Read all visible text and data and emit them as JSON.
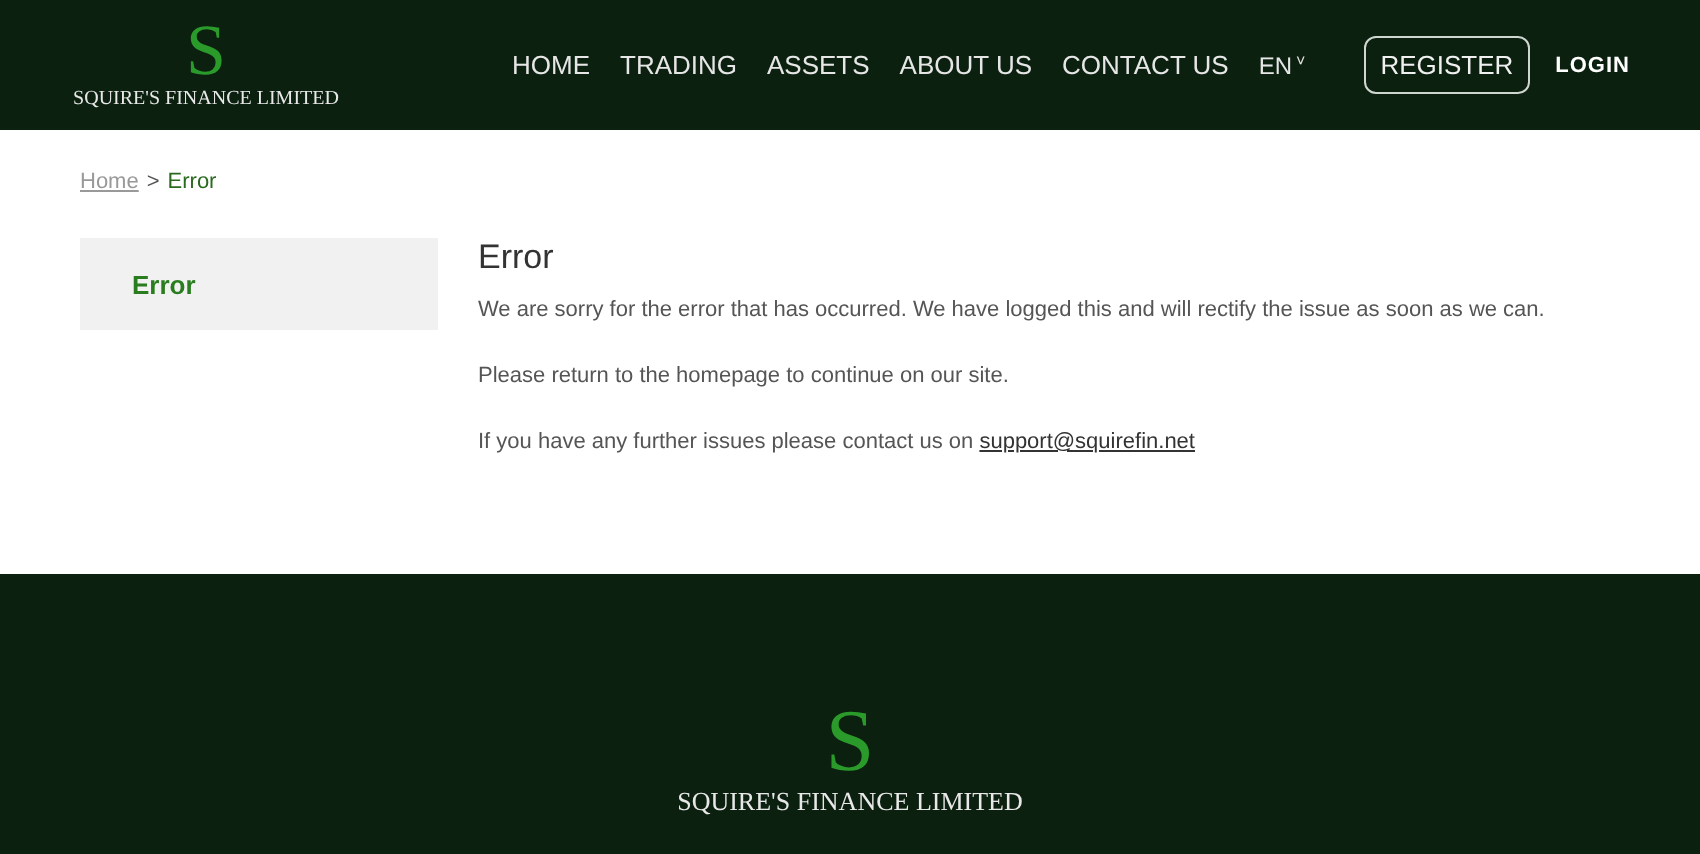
{
  "header": {
    "logo_letter": "S",
    "logo_name": "SQUIRE'S FINANCE LIMITED",
    "nav": [
      "HOME",
      "TRADING",
      "ASSETS",
      "ABOUT US",
      "CONTACT US"
    ],
    "language": "EN",
    "language_caret": "˅",
    "register": "REGISTER",
    "login": "LOGIN"
  },
  "breadcrumb": {
    "home": "Home",
    "separator": ">",
    "current": "Error"
  },
  "sidebar": {
    "items": [
      {
        "label": "Error",
        "selected": true
      }
    ]
  },
  "content": {
    "title": "Error",
    "paragraphs": [
      {
        "text": "We are sorry for the error that has occurred. We have logged this and will rectify the issue as soon as we can."
      },
      {
        "text": "Please return to the homepage to continue on our site."
      },
      {
        "text": "If you have any further issues please contact us on ",
        "link": "support@squirefin.net"
      }
    ]
  },
  "footer": {
    "logo_letter": "S",
    "logo_name": "SQUIRE'S FINANCE LIMITED"
  }
}
